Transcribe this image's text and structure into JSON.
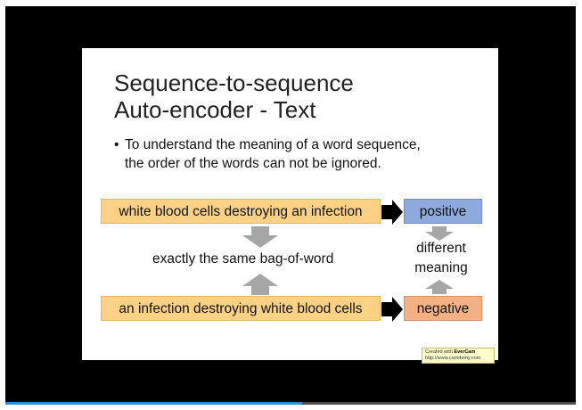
{
  "slide": {
    "title_line1": "Sequence-to-sequence",
    "title_line2": "Auto-encoder - Text",
    "bullet_line1": "To understand the meaning of a word sequence,",
    "bullet_line2": "the order of the words can not be ignored.",
    "sentence_top": "white blood cells destroying an infection",
    "sentence_bottom": "an infection destroying white blood cells",
    "label_positive": "positive",
    "label_negative": "negative",
    "bag_of_word": "exactly the same bag-of-word",
    "different_line1": "different",
    "different_line2": "meaning"
  },
  "watermark": {
    "line1_prefix": "Created with ",
    "brand": "EverCam",
    "line2": "http://www.camdemy.com"
  },
  "player": {
    "progress_fraction": 0.52
  },
  "colors": {
    "player_bg": "#000000",
    "sentence_fill": "#fbd285",
    "positive_fill": "#8ea9db",
    "negative_fill": "#f4b183",
    "gray_arrow": "#a6a6a6",
    "progress": "#2e8fd6"
  }
}
